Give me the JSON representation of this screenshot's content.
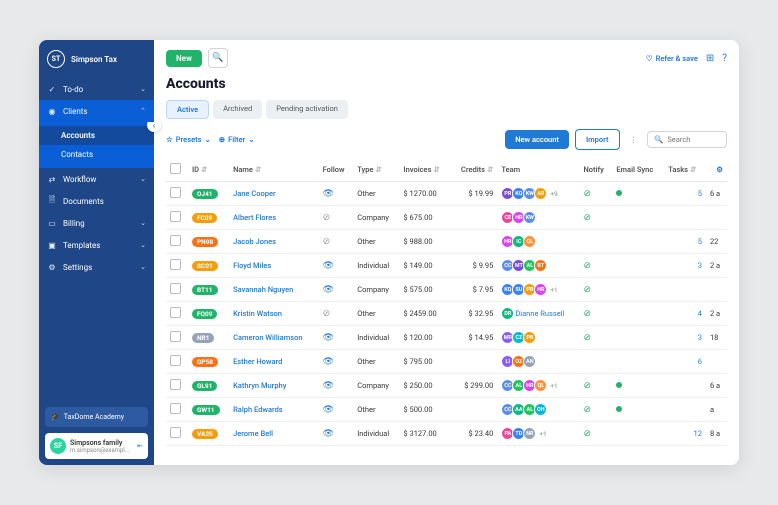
{
  "brand": {
    "badge": "ST",
    "name": "Simpson Tax"
  },
  "nav": {
    "todo": "To-do",
    "clients": "Clients",
    "accounts": "Accounts",
    "contacts": "Contacts",
    "workflow": "Workflow",
    "documents": "Documents",
    "billing": "Billing",
    "templates": "Templates",
    "settings": "Settings"
  },
  "sidebar": {
    "academy": "TaxDome Academy"
  },
  "user": {
    "initials": "SF",
    "name": "Simpsons family",
    "email": "m.simpson@exampl..."
  },
  "topbar": {
    "new": "New",
    "refer": "Refer & save"
  },
  "page": {
    "title": "Accounts"
  },
  "tabs": [
    "Active",
    "Archived",
    "Pending activation"
  ],
  "toolbar": {
    "presets": "Presets",
    "filter": "Filter",
    "new_account": "New account",
    "import": "Import",
    "search_placeholder": "Search"
  },
  "cols": {
    "id": "ID",
    "name": "Name",
    "follow": "Follow",
    "type": "Type",
    "invoices": "Invoices",
    "credits": "Credits",
    "team": "Team",
    "notify": "Notify",
    "emailsync": "Email Sync",
    "tasks": "Tasks"
  },
  "team_colors": {
    "PR": "#7b4dd6",
    "KQ": "#3b82f6",
    "KW": "#5b8df0",
    "AB": "#f59e0b",
    "CE": "#e64a9c",
    "HR": "#d946ef",
    "IC": "#10b981",
    "QL": "#fb923c",
    "MT": "#7b4dd6",
    "AL": "#22c55e",
    "BT": "#f97316",
    "SU": "#3b82f6",
    "PB": "#f59e0b",
    "DR": "#10b981",
    "MR": "#8b5cf6",
    "CZ": "#06b6d4",
    "LI": "#8b5cf6",
    "OZ": "#f97316",
    "AN": "#94a3b8",
    "CC": "#5b8def",
    "AA": "#10b981",
    "OH": "#06b6d4",
    "PA": "#ec4899",
    "TD": "#3b82f6",
    "NR": "#94a3b8"
  },
  "rows": [
    {
      "tag": "OJ41",
      "tc": "#22b36b",
      "name": "Jane Cooper",
      "follow": true,
      "type": "Other",
      "inv": "$ 1270.00",
      "cred": "$ 19.99",
      "team": [
        "PR",
        "KQ",
        "KW",
        "AB"
      ],
      "more": "+9",
      "notify": true,
      "sync": "dot",
      "tasks": 5,
      "last": "6 a"
    },
    {
      "tag": "FC09",
      "tc": "#f59e0b",
      "name": "Albert Flores",
      "follow": false,
      "type": "Company",
      "inv": "$ 675.00",
      "cred": "",
      "team": [
        "CE",
        "HR",
        "KW"
      ],
      "more": "",
      "notify": true,
      "sync": "",
      "tasks": "",
      "last": ""
    },
    {
      "tag": "PN98",
      "tc": "#f97316",
      "name": "Jacob Jones",
      "follow": false,
      "type": "Other",
      "inv": "$ 988.00",
      "cred": "",
      "team": [
        "HR",
        "IC",
        "QL"
      ],
      "more": "",
      "notify": "",
      "sync": "",
      "tasks": 5,
      "last": "22"
    },
    {
      "tag": "SC01",
      "tc": "#f59e0b",
      "name": "Floyd Miles",
      "follow": true,
      "type": "Individual",
      "inv": "$ 149.00",
      "cred": "$ 9.95",
      "team": [
        "CC",
        "MT",
        "AL",
        "BT"
      ],
      "more": "",
      "notify": true,
      "sync": "",
      "tasks": 3,
      "last": "2 a"
    },
    {
      "tag": "BT11",
      "tc": "#22b36b",
      "name": "Savannah Nguyen",
      "follow": true,
      "type": "Company",
      "inv": "$ 575.00",
      "cred": "$ 7.95",
      "team": [
        "KQ",
        "SU",
        "PB",
        "HR"
      ],
      "more": "+1",
      "notify": true,
      "sync": "",
      "tasks": "",
      "last": ""
    },
    {
      "tag": "FQ09",
      "tc": "#22b36b",
      "name": "Kristin Watson",
      "follow": false,
      "type": "Other",
      "inv": "$ 2459.00",
      "cred": "$ 32.95",
      "team": [
        "DR"
      ],
      "assignee": "Dianne Russell",
      "notify": true,
      "sync": "",
      "tasks": 4,
      "last": "2 a"
    },
    {
      "tag": "NR1",
      "tc": "#94a3b8",
      "name": "Cameron Williamson",
      "follow": true,
      "type": "Individual",
      "inv": "$ 120.00",
      "cred": "$ 14.95",
      "team": [
        "MR",
        "CZ",
        "PB"
      ],
      "more": "",
      "notify": true,
      "sync": "",
      "tasks": 3,
      "last": "18"
    },
    {
      "tag": "GP58",
      "tc": "#f97316",
      "name": "Esther Howard",
      "follow": true,
      "type": "Other",
      "inv": "$ 795.00",
      "cred": "",
      "team": [
        "LI",
        "OZ",
        "AN"
      ],
      "more": "",
      "notify": "",
      "sync": "",
      "tasks": 6,
      "last": ""
    },
    {
      "tag": "GL91",
      "tc": "#22b36b",
      "name": "Kathryn Murphy",
      "follow": true,
      "type": "Company",
      "inv": "$ 250.00",
      "cred": "$ 299.00",
      "team": [
        "CC",
        "AL",
        "HR",
        "QL"
      ],
      "more": "+1",
      "notify": true,
      "sync": "dot",
      "tasks": "",
      "last": "6 a"
    },
    {
      "tag": "GW11",
      "tc": "#22b36b",
      "name": "Ralph Edwards",
      "follow": true,
      "type": "Other",
      "inv": "$ 500.00",
      "cred": "",
      "team": [
        "CC",
        "AA",
        "AL",
        "OH"
      ],
      "more": "",
      "notify": true,
      "sync": "dot",
      "tasks": "",
      "last": "a"
    },
    {
      "tag": "VA35",
      "tc": "#f59e0b",
      "name": "Jerome Bell",
      "follow": true,
      "type": "Individual",
      "inv": "$ 3127.00",
      "cred": "$ 23.40",
      "team": [
        "PA",
        "TD",
        "NR"
      ],
      "more": "+1",
      "notify": true,
      "sync": "",
      "tasks": 12,
      "last": "8 a"
    }
  ]
}
